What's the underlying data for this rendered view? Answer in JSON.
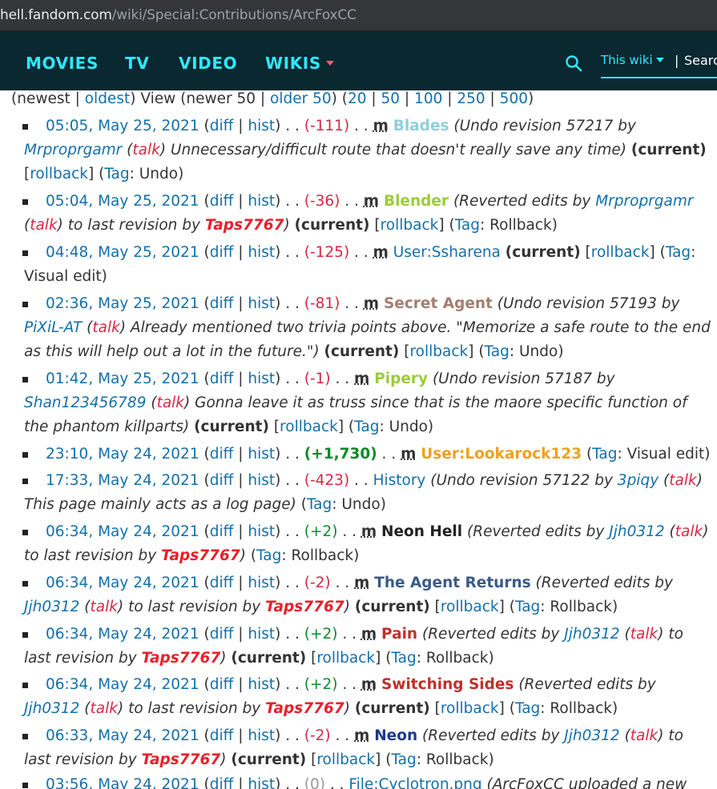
{
  "browser": {
    "url_host": "hell.fandom.com",
    "url_path": "/wiki/Special:Contributions/ArcFoxCC"
  },
  "nav": {
    "items": [
      "MOVIES",
      "TV",
      "VIDEO",
      "WIKIS"
    ],
    "search_scope": "This wiki",
    "search_placeholder": "Searc",
    "accent_color": "#2ee8ff",
    "background_color": "#0a2830"
  },
  "pager": {
    "newest": "newest",
    "oldest": "oldest",
    "view": "View",
    "newer": "newer 50",
    "older": "older 50",
    "limits": [
      "20",
      "50",
      "100",
      "250",
      "500"
    ]
  },
  "labels": {
    "diff": "diff",
    "hist": "hist",
    "talk": "talk",
    "current": "(current)",
    "rollback": "rollback",
    "tag": "Tag",
    "minor": "m",
    "dots": ". .",
    "by": "by"
  },
  "entries": [
    {
      "time": "05:05, May 25, 2021",
      "size": "(-111)",
      "size_kind": "neg",
      "minor": true,
      "page": "Blades",
      "page_color": "#8fcfd8",
      "page_bold": true,
      "summary": "(Undo revision 57217 by ",
      "user": "Mrproprgamr",
      "summary2": ") Unnecessary/difficult route that doesn't really save any time)",
      "current": true,
      "rollback": true,
      "tag": "Undo"
    },
    {
      "time": "05:04, May 25, 2021",
      "size": "(-36)",
      "size_kind": "neg",
      "minor": true,
      "page": "Blender",
      "page_color": "#9ccc3a",
      "page_bold": true,
      "summary": "(Reverted edits by ",
      "user": "Mrproprgamr",
      "summary2": ") to last revision by ",
      "taps": "Taps7767",
      "summary3": ")",
      "current": true,
      "rollback": true,
      "tag": "Rollback"
    },
    {
      "time": "04:48, May 25, 2021",
      "size": "(-125)",
      "size_kind": "neg",
      "minor": true,
      "page": "User:Ssharena",
      "page_color": "#146fa8",
      "page_bold": false,
      "current": true,
      "rollback": true,
      "tag": "Visual edit"
    },
    {
      "time": "02:36, May 25, 2021",
      "size": "(-81)",
      "size_kind": "neg",
      "minor": true,
      "page": "Secret Agent",
      "page_color": "#a08070",
      "page_bold": true,
      "summary": "(Undo revision 57193 by ",
      "user": "PiXiL-AT",
      "summary2": ") Already mentioned two trivia points above. \"Memorize a safe route to the end as this will help out a lot in the future.\")",
      "current": true,
      "rollback": true,
      "tag": "Undo"
    },
    {
      "time": "01:42, May 25, 2021",
      "size": "(-1)",
      "size_kind": "neg",
      "minor": true,
      "page": "Pipery",
      "page_color": "#9ccc3a",
      "page_bold": true,
      "summary": "(Undo revision 57187 by ",
      "user": "Shan123456789",
      "summary2": ") Gonna leave it as truss since that is the maore specific function of the phantom killparts)",
      "current": true,
      "rollback": true,
      "tag": "Undo"
    },
    {
      "time": "23:10, May 24, 2021",
      "size": "(+1,730)",
      "size_kind": "bigpos",
      "minor": true,
      "page": "User:Lookarock123",
      "page_color": "#f0a020",
      "page_bold": true,
      "current": false,
      "rollback": false,
      "tag": "Visual edit"
    },
    {
      "time": "17:33, May 24, 2021",
      "size": "(-423)",
      "size_kind": "neg",
      "minor": false,
      "page": "History",
      "page_color": "#146fa8",
      "page_bold": false,
      "summary": "(Undo revision 57122 by ",
      "user": "3piqy",
      "summary2": ") This page mainly acts as a log page)",
      "current": false,
      "rollback": false,
      "tag": "Undo"
    },
    {
      "time": "06:34, May 24, 2021",
      "size": "(+2)",
      "size_kind": "pos",
      "minor": true,
      "page": "Neon Hell",
      "page_color": "#222222",
      "page_bold": true,
      "summary": "(Reverted edits by ",
      "user": "Jjh0312",
      "summary2": ") to last revision by ",
      "taps": "Taps7767",
      "summary3": ")",
      "current": false,
      "rollback": false,
      "tag": "Rollback"
    },
    {
      "time": "06:34, May 24, 2021",
      "size": "(-2)",
      "size_kind": "neg",
      "minor": true,
      "page": "The Agent Returns",
      "page_color": "#3a5a8a",
      "page_bold": true,
      "summary": "(Reverted edits by ",
      "user": "Jjh0312",
      "summary2": ") to last revision by ",
      "taps": "Taps7767",
      "summary3": ")",
      "current": true,
      "rollback": true,
      "tag": "Rollback"
    },
    {
      "time": "06:34, May 24, 2021",
      "size": "(+2)",
      "size_kind": "pos",
      "minor": true,
      "page": "Pain",
      "page_color": "#c0302a",
      "page_bold": true,
      "summary": "(Reverted edits by ",
      "user": "Jjh0312",
      "summary2": ") to last revision by ",
      "taps": "Taps7767",
      "summary3": ")",
      "current": true,
      "rollback": true,
      "tag": "Rollback"
    },
    {
      "time": "06:34, May 24, 2021",
      "size": "(+2)",
      "size_kind": "pos",
      "minor": true,
      "page": "Switching Sides",
      "page_color": "#c0302a",
      "page_bold": true,
      "summary": "(Reverted edits by ",
      "user": "Jjh0312",
      "summary2": ") to last revision by ",
      "taps": "Taps7767",
      "summary3": ")",
      "current": true,
      "rollback": true,
      "tag": "Rollback"
    },
    {
      "time": "06:33, May 24, 2021",
      "size": "(-2)",
      "size_kind": "neg",
      "minor": true,
      "page": "Neon",
      "page_color": "#1a3a8a",
      "page_bold": true,
      "summary": "(Reverted edits by ",
      "user": "Jjh0312",
      "summary2": ") to last revision by ",
      "taps": "Taps7767",
      "summary3": ")",
      "current": true,
      "rollback": true,
      "tag": "Rollback"
    },
    {
      "time": "03:56, May 24, 2021",
      "size": "(0)",
      "size_kind": "zero",
      "minor": false,
      "page": "File:Cyclotron.png",
      "page_color": "#146fa8",
      "page_bold": false,
      "summary": "(ArcFoxCC uploaded a new",
      "current": false,
      "rollback": false,
      "tag": ""
    }
  ]
}
